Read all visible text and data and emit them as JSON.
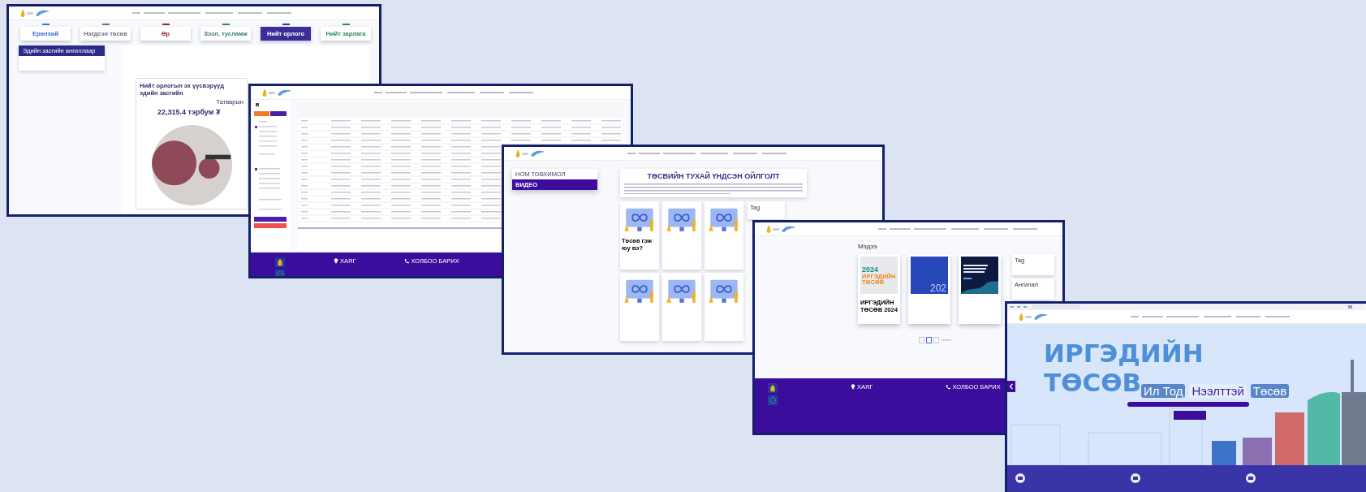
{
  "windows": [
    {
      "kind": "dashboard",
      "tabs": [
        {
          "label": "Ерөнхий",
          "selected": false,
          "color": "#3d6fd8"
        },
        {
          "label": "Нэгдсэн төсөв",
          "selected": false,
          "color": "#6b6f80"
        },
        {
          "label": "Өр",
          "selected": false,
          "color": "#8a2d3a"
        },
        {
          "label": "Зээл, тусламж",
          "selected": false,
          "color": "#3e7a6e"
        },
        {
          "label": "Нийт орлого",
          "selected": true,
          "color": "#3a2d9a"
        },
        {
          "label": "Нийт зарлага",
          "selected": false,
          "color": "#2e8a63"
        }
      ],
      "sidebar": [
        {
          "label": "Эдийн засгийн ангиллаар",
          "selected": true
        }
      ],
      "chart_card": {
        "title": "Нийт орлогын эх үүсвэрүүд эдийн засгийн",
        "subtitle": "Татварын",
        "total": "22,315.4 тэрбум ₮"
      }
    },
    {
      "kind": "table",
      "footer": {
        "address_heading": "ХАЯГ",
        "contact_heading": "ХОЛБОО БАРИХ"
      }
    },
    {
      "kind": "videos",
      "menu": [
        {
          "label": "НОМ ТОВХИМОЛ",
          "selected": false
        },
        {
          "label": "ВИДЕО",
          "selected": true
        }
      ],
      "heading": "ТӨСВИЙН ТУХАЙ ҮНДСЭН ОЙЛГОЛТ",
      "cards": [
        {
          "title": "Төсөв гэж юу вэ?"
        },
        {
          "kind": "video"
        },
        {
          "kind": "video"
        },
        {
          "kind": "video"
        },
        {
          "kind": "video"
        },
        {
          "kind": "video"
        }
      ],
      "tag_heading": "Tag"
    },
    {
      "kind": "news",
      "heading": "Мэдээ",
      "cards": [
        {
          "kind": "citizen",
          "cover_year": "2024",
          "cover_title": "ИРГЭДИЙН ТӨСӨВ",
          "title": "ИРГЭДИЙН ТӨСӨВ 2024"
        },
        {
          "kind": "blue",
          "cover_year": "202"
        },
        {
          "kind": "navy"
        }
      ],
      "tag_heading": "Tag",
      "category_heading": "Ангилал",
      "footer": {
        "address_heading": "ХАЯГ",
        "contact_heading": "ХОЛБОО БАРИХ"
      }
    },
    {
      "kind": "hero",
      "title_lines": [
        "ИРГЭДИЙН",
        "ТӨСӨВ"
      ],
      "slogan": [
        {
          "text": "Ил Тод",
          "accent": false
        },
        {
          "text": "Нээлттэй",
          "accent": true
        },
        {
          "text": "Төсөв",
          "accent": false
        }
      ]
    }
  ]
}
